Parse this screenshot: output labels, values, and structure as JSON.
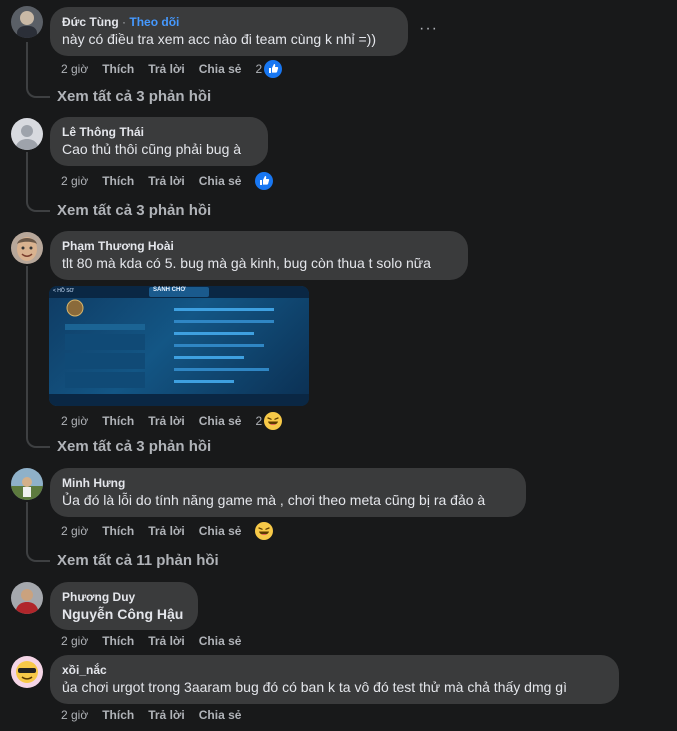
{
  "comments": [
    {
      "author": "Đức Tùng",
      "follow_label": "Theo dõi",
      "separator": "·",
      "text": "này có điều tra xem acc nào đi team cùng k nhỉ =))",
      "time": "2 giờ",
      "like": "Thích",
      "reply": "Trả lời",
      "share": "Chia sẻ",
      "reaction_count": "2",
      "reaction_icon": "like-icon",
      "more_label": "···",
      "view_replies": "Xem tất cả 3 phản hồi"
    },
    {
      "author": "Lê Thông Thái",
      "text": "Cao thủ thôi cũng phải bug à",
      "time": "2 giờ",
      "like": "Thích",
      "reply": "Trả lời",
      "share": "Chia sẻ",
      "reaction_icon": "like-icon",
      "view_replies": "Xem tất cả 3 phản hồi"
    },
    {
      "author": "Phạm Thương Hoài",
      "text": "tlt 80 mà kda có 5. bug mà gà kinh, bug còn thua t solo nữa",
      "time": "2 giờ",
      "like": "Thích",
      "reply": "Trả lời",
      "share": "Chia sẻ",
      "reaction_count": "2",
      "reaction_icon": "haha-icon",
      "view_replies": "Xem tất cả 3 phản hồi",
      "attachment": {
        "top_label": "SẢNH CHỜ",
        "back_label": "< HỒ SƠ"
      }
    },
    {
      "author": "Minh Hưng",
      "text": "Ủa đó là lỗi do tính năng game mà , chơi theo meta cũng bị ra đảo à",
      "time": "2 giờ",
      "like": "Thích",
      "reply": "Trả lời",
      "share": "Chia sẻ",
      "reaction_icon": "haha-icon",
      "view_replies": "Xem tất cả 11 phản hồi"
    },
    {
      "author": "Phương Duy",
      "text": "Nguyễn Công Hậu",
      "time": "2 giờ",
      "like": "Thích",
      "reply": "Trả lời",
      "share": "Chia sẻ"
    },
    {
      "author": "xồi_nắc",
      "text": "ủa chơi urgot trong 3aaram bug đó có ban k ta vô đó test thử mà chả thấy dmg gì",
      "time": "2 giờ",
      "like": "Thích",
      "reply": "Trả lời",
      "share": "Chia sẻ"
    }
  ],
  "colors": {
    "background": "#18191a",
    "bubble": "#3a3b3c",
    "secondary_text": "#b0b3b8",
    "accent": "#4599ff"
  }
}
